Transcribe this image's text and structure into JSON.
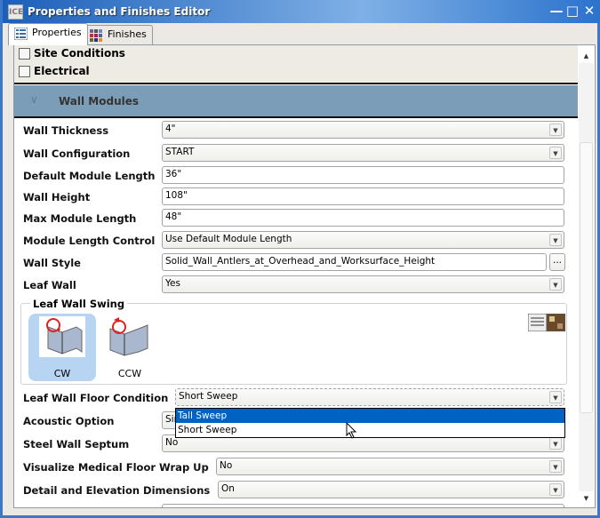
{
  "window": {
    "title": "Properties and Finishes Editor",
    "app_icon": "ICE",
    "controls": [
      "minimize",
      "maximize",
      "close"
    ]
  },
  "tabs": [
    {
      "label": "Properties",
      "icon": "list-icon",
      "active": true
    },
    {
      "label": "Finishes",
      "icon": "color-grid-icon",
      "active": false
    }
  ],
  "checkboxes": [
    {
      "label": "Site Conditions",
      "checked": false
    },
    {
      "label": "Electrical",
      "checked": false
    }
  ],
  "section": {
    "title": "Wall Modules",
    "expanded": true
  },
  "fields": [
    {
      "label": "Wall Thickness",
      "value": "4\"",
      "type": "select"
    },
    {
      "label": "Wall Configuration",
      "value": "START",
      "type": "select"
    },
    {
      "label": "Default Module Length",
      "value": "36\"",
      "type": "text"
    },
    {
      "label": "Wall Height",
      "value": "108\"",
      "type": "text"
    },
    {
      "label": "Max Module Length",
      "value": "48\"",
      "type": "text"
    },
    {
      "label": "Module Length Control",
      "value": "Use Default Module Length",
      "type": "select"
    },
    {
      "label": "Wall Style",
      "value": "Solid_Wall_Antlers_at_Overhead_and_Worksurface_Height",
      "type": "browse",
      "browse_label": "..."
    },
    {
      "label": "Leaf Wall",
      "value": "Yes",
      "type": "select"
    }
  ],
  "swing": {
    "title": "Leaf Wall Swing",
    "options": [
      {
        "label": "CW",
        "selected": true
      },
      {
        "label": "CCW",
        "selected": false
      }
    ],
    "view_toggle_icon": "list-thumbnail-toggle-icon"
  },
  "fields2": [
    {
      "label": "Leaf Wall Floor Condition",
      "value": "Short Sweep"
    },
    {
      "label": "Acoustic Option",
      "value": "Single"
    },
    {
      "label": "Steel Wall Septum",
      "value": "No"
    },
    {
      "label": "Visualize Medical Floor Wrap Up",
      "value": "No"
    },
    {
      "label": "Detail and Elevation Dimensions",
      "value": "On"
    }
  ],
  "dropdown": {
    "options": [
      "Tall Sweep",
      "Short Sweep"
    ],
    "highlighted": "Tall Sweep"
  },
  "colors": {
    "title_bar": "#1b5fb9",
    "section_header": "#7b9db7",
    "highlight": "#0062c3",
    "selected_option": "#b7d5f2"
  }
}
